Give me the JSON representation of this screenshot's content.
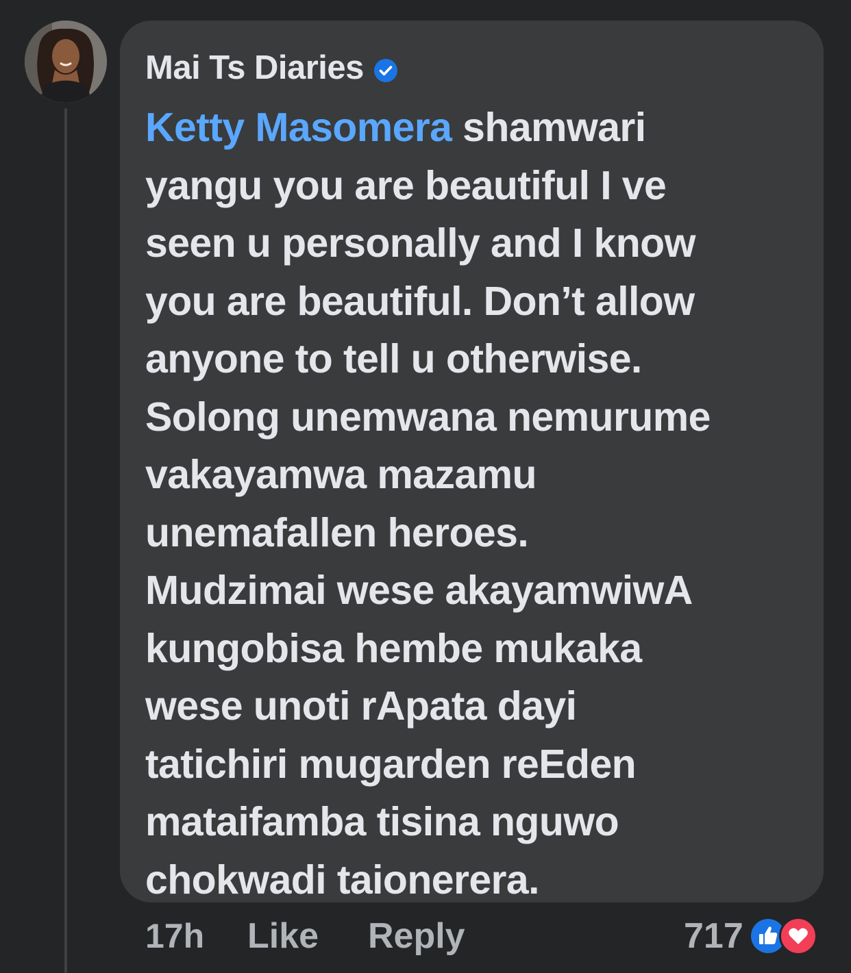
{
  "comment": {
    "author": "Mai Ts Diaries",
    "verified": true,
    "mention": "Ketty Masomera",
    "text_lines": [
      " shamwari",
      "yangu you are beautiful I ve",
      "seen u personally and I know",
      "you are beautiful. Don’t allow",
      "anyone to tell u otherwise.",
      "Solong unemwana nemurume",
      "vakayamwa mazamu",
      "unemafallen heroes.",
      "Mudzimai wese akayamwiwA",
      "kungobisa hembe mukaka",
      "wese unoti rApata dayi",
      "tatichiri mugarden reEden",
      "mataifamba tisina nguwo",
      "chokwadi taionerera."
    ]
  },
  "footer": {
    "time": "17h",
    "like_label": "Like",
    "reply_label": "Reply",
    "reaction_count": "717",
    "reaction_icons": [
      "like-icon",
      "love-icon"
    ]
  },
  "colors": {
    "background": "#242526",
    "bubble": "#3a3b3c",
    "text": "#e4e6eb",
    "mention": "#5aa7ff",
    "secondary": "#b0b3b8",
    "verified": "#1b74e4",
    "like": "#1b74e4",
    "love": "#f33e58"
  }
}
